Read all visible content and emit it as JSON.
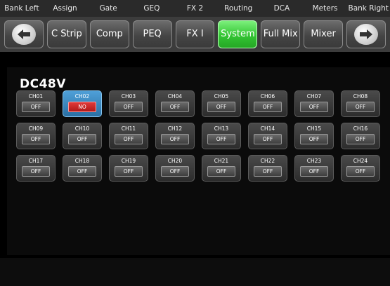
{
  "softkeys": [
    "Bank Left",
    "Assign",
    "Gate",
    "GEQ",
    "FX 2",
    "Routing",
    "DCA",
    "Meters",
    "Bank Right"
  ],
  "toolbar": {
    "buttons": [
      "C Strip",
      "Comp",
      "PEQ",
      "FX I",
      "System",
      "Full Mix",
      "Mixer"
    ],
    "active": "System",
    "active_color": "#33c433"
  },
  "section": {
    "title": "DC48V"
  },
  "channels": [
    {
      "label": "CH01",
      "state": "OFF"
    },
    {
      "label": "CH02",
      "state": "NO"
    },
    {
      "label": "CH03",
      "state": "OFF"
    },
    {
      "label": "CH04",
      "state": "OFF"
    },
    {
      "label": "CH05",
      "state": "OFF"
    },
    {
      "label": "CH06",
      "state": "OFF"
    },
    {
      "label": "CH07",
      "state": "OFF"
    },
    {
      "label": "CH08",
      "state": "OFF"
    },
    {
      "label": "CH09",
      "state": "OFF"
    },
    {
      "label": "CH10",
      "state": "OFF"
    },
    {
      "label": "CH11",
      "state": "OFF"
    },
    {
      "label": "CH12",
      "state": "OFF"
    },
    {
      "label": "CH13",
      "state": "OFF"
    },
    {
      "label": "CH14",
      "state": "OFF"
    },
    {
      "label": "CH15",
      "state": "OFF"
    },
    {
      "label": "CH16",
      "state": "OFF"
    },
    {
      "label": "CH17",
      "state": "OFF"
    },
    {
      "label": "CH18",
      "state": "OFF"
    },
    {
      "label": "CH19",
      "state": "OFF"
    },
    {
      "label": "CH20",
      "state": "OFF"
    },
    {
      "label": "CH21",
      "state": "OFF"
    },
    {
      "label": "CH22",
      "state": "OFF"
    },
    {
      "label": "CH23",
      "state": "OFF"
    },
    {
      "label": "CH24",
      "state": "OFF"
    }
  ],
  "selected_channel": "CH02",
  "colors": {
    "selected_tile": "#2a6fa3",
    "on_toggle": "#c42020"
  },
  "icons": {
    "left": "arrow-left-icon",
    "right": "arrow-right-icon"
  }
}
